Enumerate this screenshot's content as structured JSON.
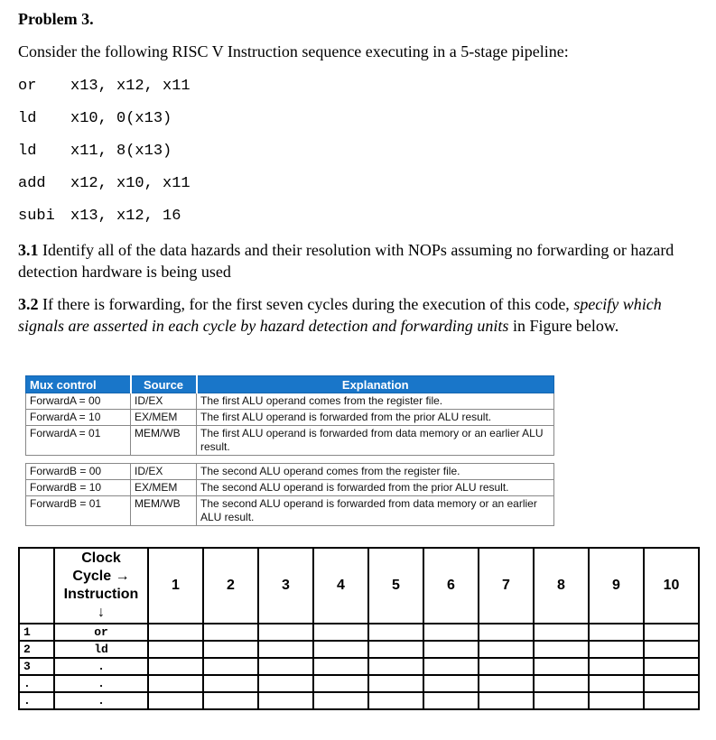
{
  "problem": {
    "title": "Problem 3.",
    "intro": "Consider the following RISC V Instruction sequence executing in a 5-stage pipeline:",
    "code": [
      {
        "op": "or",
        "args": "x13, x12, x11"
      },
      {
        "op": "ld",
        "args": "x10, 0(x13)"
      },
      {
        "op": "ld",
        "args": "x11, 8(x13)"
      },
      {
        "op": "add",
        "args": "x12, x10, x11"
      },
      {
        "op": "subi",
        "args": "x13, x12, 16"
      }
    ]
  },
  "q31": {
    "num": "3.1",
    "text": " Identify all of the data hazards and their resolution with NOPs assuming no forwarding or hazard detection hardware is being used"
  },
  "q32": {
    "num": "3.2",
    "text_a": " If there is forwarding, for the first seven cycles during the execution of this code, ",
    "text_italic": "specify which signals are asserted in each cycle by hazard detection and forwarding units",
    "text_b": " in Figure below."
  },
  "mux_table": {
    "headers": [
      "Mux control",
      "Source",
      "Explanation"
    ],
    "rows_a": [
      {
        "control": "ForwardA = 00",
        "source": "ID/EX",
        "explanation": "The first ALU operand comes from the register file."
      },
      {
        "control": "ForwardA = 10",
        "source": "EX/MEM",
        "explanation": "The first ALU operand is forwarded from the prior ALU result."
      },
      {
        "control": "ForwardA = 01",
        "source": "MEM/WB",
        "explanation": "The first ALU operand is forwarded from data memory or an earlier ALU result."
      }
    ],
    "rows_b": [
      {
        "control": "ForwardB = 00",
        "source": "ID/EX",
        "explanation": "The second ALU operand comes from the register file."
      },
      {
        "control": "ForwardB = 10",
        "source": "EX/MEM",
        "explanation": "The second ALU operand is forwarded from the prior ALU result."
      },
      {
        "control": "ForwardB = 01",
        "source": "MEM/WB",
        "explanation": "The second ALU operand is forwarded from data memory or an earlier ALU result."
      }
    ]
  },
  "pipeline_table": {
    "header_label_lines": [
      "Clock",
      "Cycle →",
      "Instruction",
      "↓"
    ],
    "cycles": [
      "1",
      "2",
      "3",
      "4",
      "5",
      "6",
      "7",
      "8",
      "9",
      "10"
    ],
    "rows": [
      {
        "index": "1",
        "instruction": "or"
      },
      {
        "index": "2",
        "instruction": "ld"
      },
      {
        "index": "3",
        "instruction": "."
      },
      {
        "index": ".",
        "instruction": "."
      },
      {
        "index": ".",
        "instruction": "."
      }
    ]
  }
}
